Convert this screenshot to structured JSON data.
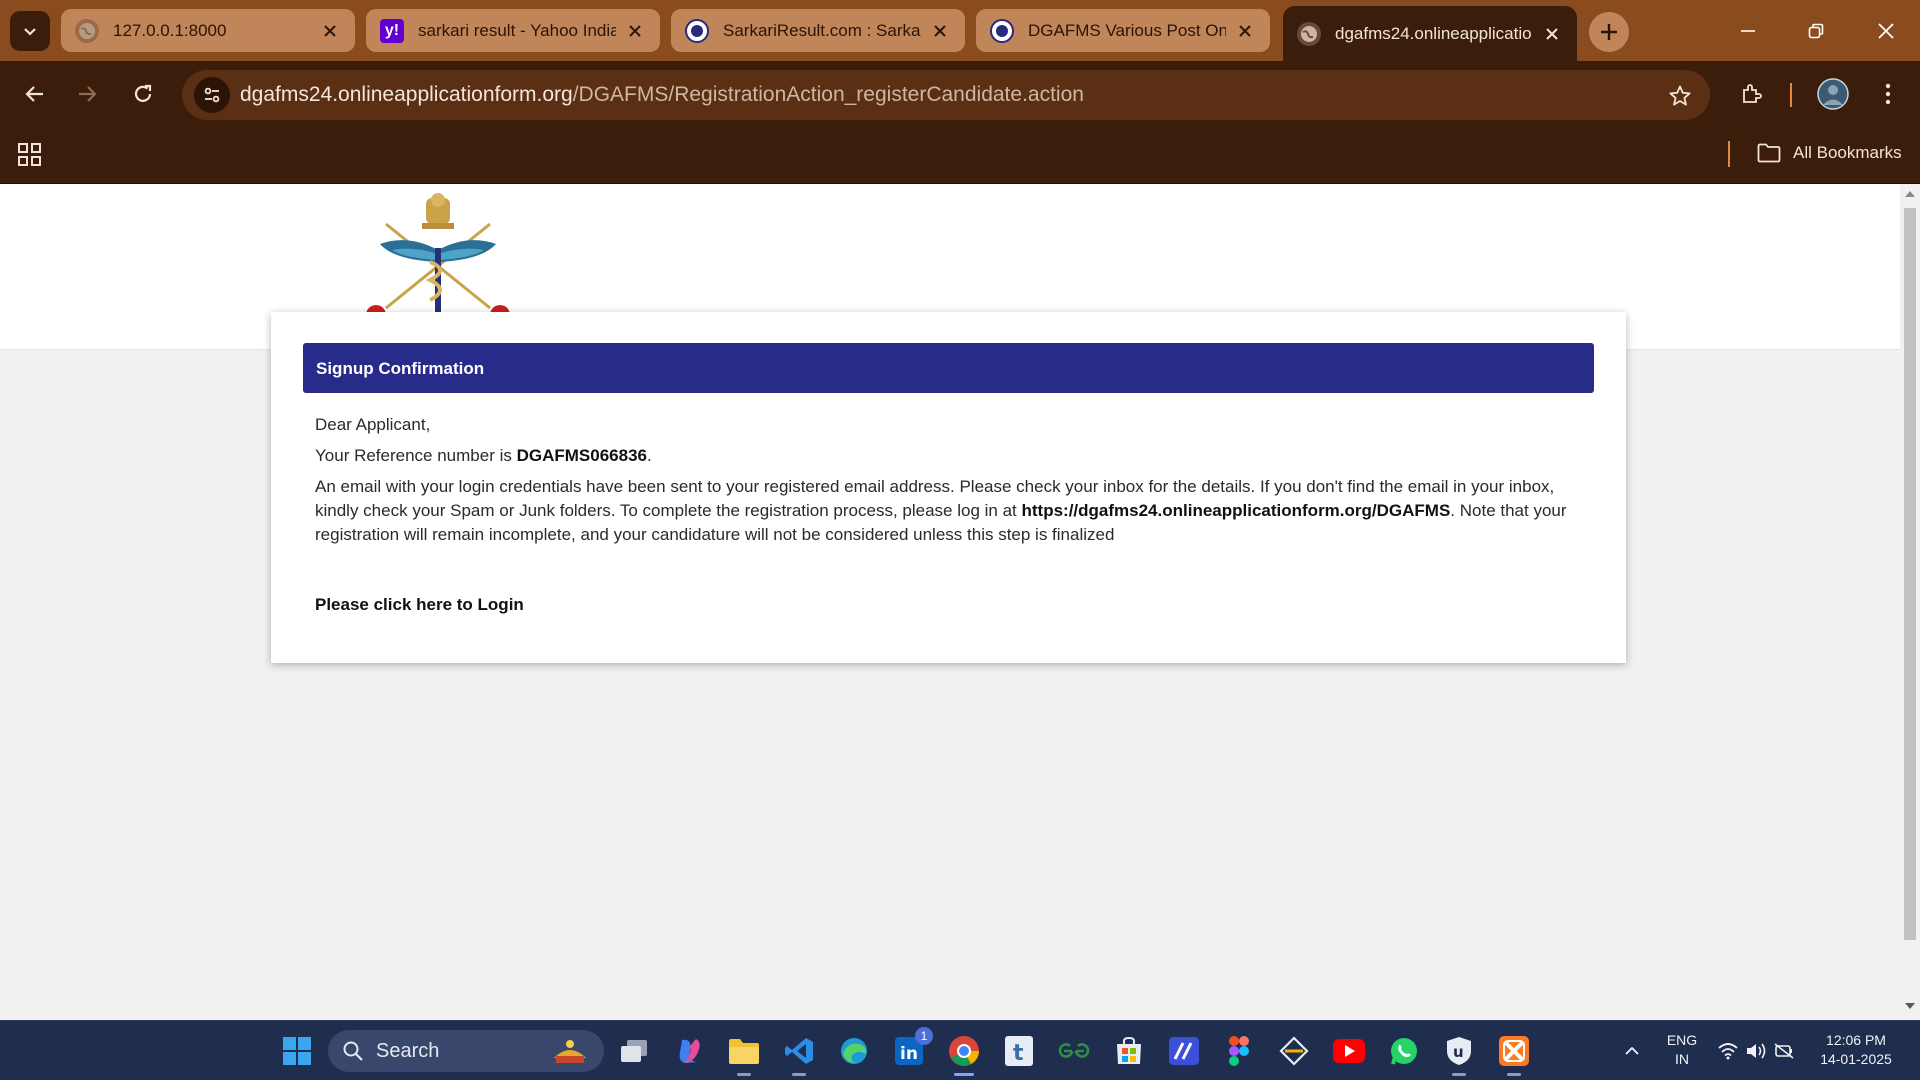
{
  "browser": {
    "tabs": [
      {
        "title": "127.0.0.1:8000",
        "active": false
      },
      {
        "title": "sarkari result - Yahoo India",
        "active": false
      },
      {
        "title": "SarkariResult.com : Sarkari",
        "active": false
      },
      {
        "title": "DGAFMS Various Post Onli",
        "active": false
      },
      {
        "title": "dgafms24.onlineapplicatio",
        "active": true
      }
    ],
    "url_domain": "dgafms24.onlineapplicationform.org",
    "url_path": "/DGAFMS/RegistrationAction_registerCandidate.action",
    "bookmarks_label": "All Bookmarks",
    "colors": {
      "tabstrip": "#8a4b1e",
      "toolbar": "#3a1d0b",
      "omnibox": "#5a2f14"
    }
  },
  "page": {
    "card_title": "Signup Confirmation",
    "greeting": "Dear Applicant,",
    "reference_prefix": "Your Reference number is ",
    "reference_number": "DGAFMS066836",
    "reference_suffix": ".",
    "message_part1": "An email with your login credentials have been sent to your registered email address. Please check your inbox for the details. If you don't find the email in your inbox, kindly check your Spam or Junk folders. To complete the registration process, please log in at ",
    "login_url": "https://dgafms24.onlineapplicationform.org/DGAFMS",
    "message_part2": ". Note that your registration will remain incomplete, and your candidature will not be considered unless this step is finalized",
    "login_link": "Please click here to Login",
    "colors": {
      "header_bar": "#282b8a"
    }
  },
  "taskbar": {
    "search_label": "Search",
    "notification_count": "1",
    "language_line1": "ENG",
    "language_line2": "IN",
    "time": "12:06 PM",
    "date": "14-01-2025"
  }
}
